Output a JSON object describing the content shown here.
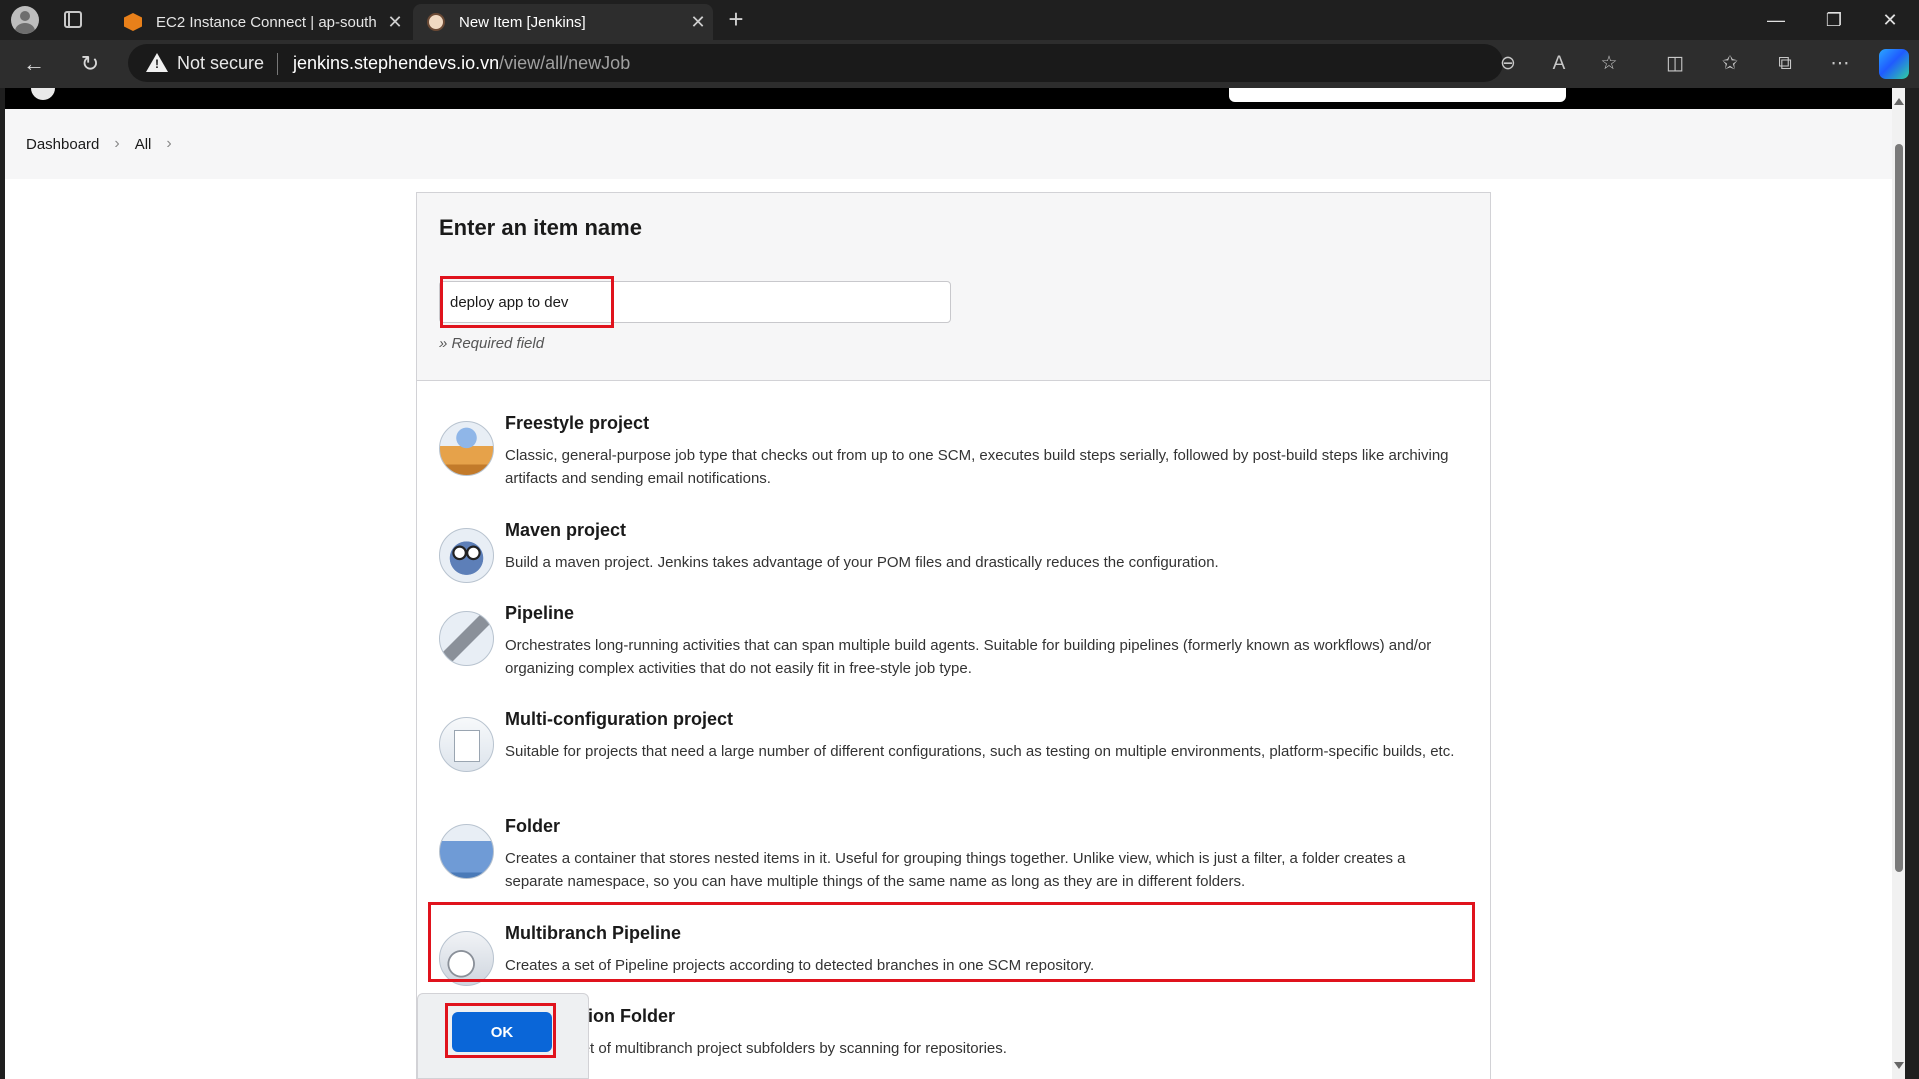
{
  "browser": {
    "tabs": [
      {
        "title": "EC2 Instance Connect | ap-south",
        "icon": "aws-icon",
        "active": false
      },
      {
        "title": "New Item [Jenkins]",
        "icon": "jenkins-icon",
        "active": true
      }
    ],
    "security_label": "Not secure",
    "url_host": "jenkins.stephendevs.io.vn",
    "url_path": "/view/all/newJob"
  },
  "breadcrumbs": {
    "dashboard": "Dashboard",
    "all": "All",
    "separator": ">"
  },
  "form": {
    "heading": "Enter an item name",
    "item_name_value": "deploy app to dev",
    "required_note": "» Required field",
    "ok_label": "OK"
  },
  "item_types": [
    {
      "title": "Freestyle project",
      "desc": "Classic, general-purpose job type that checks out from up to one SCM, executes build steps serially, followed by post-build steps like archiving artifacts and sending email notifications.",
      "icon": "freestyle-project-icon"
    },
    {
      "title": "Maven project",
      "desc": "Build a maven project. Jenkins takes advantage of your POM files and drastically reduces the configuration.",
      "icon": "maven-project-icon"
    },
    {
      "title": "Pipeline",
      "desc": "Orchestrates long-running activities that can span multiple build agents. Suitable for building pipelines (formerly known as workflows) and/or organizing complex activities that do not easily fit in free-style job type.",
      "icon": "pipeline-icon"
    },
    {
      "title": "Multi-configuration project",
      "desc": "Suitable for projects that need a large number of different configurations, such as testing on multiple environments, platform-specific builds, etc.",
      "icon": "multi-configuration-icon"
    },
    {
      "title": "Folder",
      "desc": "Creates a container that stores nested items in it. Useful for grouping things together. Unlike view, which is just a filter, a folder creates a separate namespace, so you can have multiple things of the same name as long as they are in different folders.",
      "icon": "folder-icon"
    },
    {
      "title": "Multibranch Pipeline",
      "desc": "Creates a set of Pipeline projects according to detected branches in one SCM repository.",
      "icon": "multibranch-pipeline-icon"
    },
    {
      "title": "Organization Folder",
      "desc": "Creates a set of multibranch project subfolders by scanning for repositories.",
      "icon": "organization-folder-icon"
    }
  ],
  "colors": {
    "highlight": "#e0131d",
    "ok_button": "#0a66d8"
  }
}
